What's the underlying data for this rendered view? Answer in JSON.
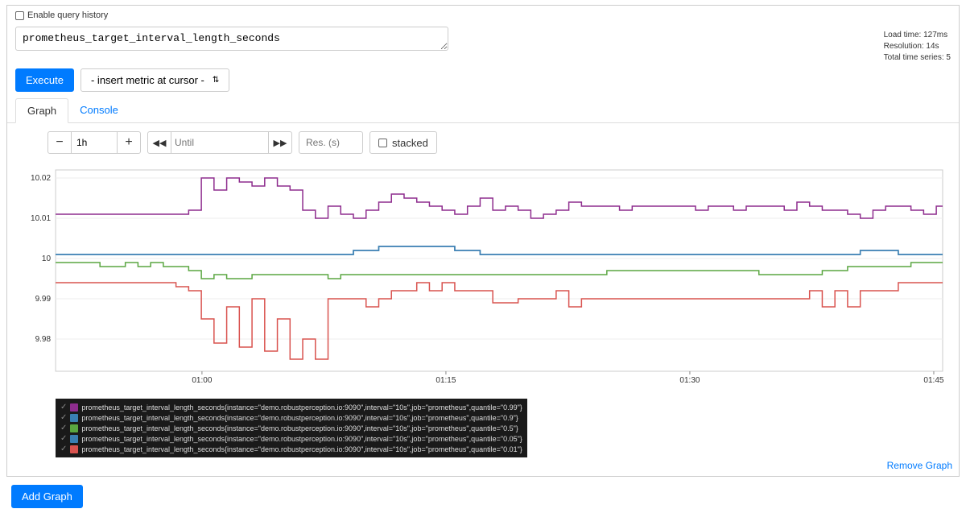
{
  "topbar": {
    "enable_history": "Enable query history"
  },
  "query": {
    "value": "prometheus_target_interval_length_seconds"
  },
  "stats": {
    "load": "Load time: 127ms",
    "res": "Resolution: 14s",
    "series": "Total time series: 5"
  },
  "buttons": {
    "execute": "Execute",
    "insert": "- insert metric at cursor -",
    "add_graph": "Add Graph"
  },
  "tabs": {
    "graph": "Graph",
    "console": "Console"
  },
  "toolbar": {
    "range": "1h",
    "until_ph": "Until",
    "res_ph": "Res. (s)",
    "stacked": "stacked"
  },
  "footer": {
    "remove": "Remove Graph"
  },
  "chart_data": {
    "type": "line",
    "title": "",
    "xlabel": "",
    "ylabel": "",
    "ylim": [
      9.972,
      10.022
    ],
    "yticks": [
      9.98,
      9.99,
      10,
      10.01,
      10.02
    ],
    "x_categories": [
      "01:00",
      "01:15",
      "01:30",
      "01:45"
    ],
    "series": [
      {
        "name": "quantile=\"0.99\"",
        "color": "#8e2d8e",
        "values": [
          10.011,
          10.011,
          10.011,
          10.011,
          10.011,
          10.011,
          10.011,
          10.011,
          10.011,
          10.011,
          10.011,
          10.012,
          10.02,
          10.017,
          10.02,
          10.019,
          10.018,
          10.02,
          10.018,
          10.017,
          10.012,
          10.01,
          10.013,
          10.011,
          10.01,
          10.012,
          10.014,
          10.016,
          10.015,
          10.014,
          10.013,
          10.012,
          10.011,
          10.013,
          10.015,
          10.012,
          10.013,
          10.012,
          10.01,
          10.011,
          10.012,
          10.014,
          10.013,
          10.013,
          10.013,
          10.012,
          10.013,
          10.013,
          10.013,
          10.013,
          10.013,
          10.012,
          10.013,
          10.013,
          10.012,
          10.013,
          10.013,
          10.013,
          10.012,
          10.014,
          10.013,
          10.012,
          10.012,
          10.011,
          10.01,
          10.012,
          10.013,
          10.013,
          10.012,
          10.011,
          10.013
        ]
      },
      {
        "name": "quantile=\"0.9\"",
        "color": "#3a7fb2",
        "values": [
          10.001,
          10.001,
          10.001,
          10.001,
          10.001,
          10.001,
          10.001,
          10.001,
          10.001,
          10.001,
          10.001,
          10.001,
          10.001,
          10.001,
          10.001,
          10.001,
          10.001,
          10.001,
          10.001,
          10.001,
          10.001,
          10.001,
          10.001,
          10.001,
          10.002,
          10.002,
          10.003,
          10.003,
          10.003,
          10.003,
          10.003,
          10.003,
          10.002,
          10.002,
          10.001,
          10.001,
          10.001,
          10.001,
          10.001,
          10.001,
          10.001,
          10.001,
          10.001,
          10.001,
          10.001,
          10.001,
          10.001,
          10.001,
          10.001,
          10.001,
          10.001,
          10.001,
          10.001,
          10.001,
          10.001,
          10.001,
          10.001,
          10.001,
          10.001,
          10.001,
          10.001,
          10.001,
          10.001,
          10.001,
          10.002,
          10.002,
          10.002,
          10.001,
          10.001,
          10.001,
          10.001
        ]
      },
      {
        "name": "quantile=\"0.5\"",
        "color": "#5aa641",
        "values": [
          9.999,
          9.999,
          9.999,
          9.999,
          9.998,
          9.998,
          9.999,
          9.998,
          9.999,
          9.998,
          9.998,
          9.997,
          9.995,
          9.996,
          9.995,
          9.995,
          9.996,
          9.996,
          9.996,
          9.996,
          9.996,
          9.996,
          9.995,
          9.996,
          9.996,
          9.996,
          9.996,
          9.996,
          9.996,
          9.996,
          9.996,
          9.996,
          9.996,
          9.996,
          9.996,
          9.996,
          9.996,
          9.996,
          9.996,
          9.996,
          9.996,
          9.996,
          9.996,
          9.996,
          9.997,
          9.997,
          9.997,
          9.997,
          9.997,
          9.997,
          9.997,
          9.997,
          9.997,
          9.997,
          9.997,
          9.997,
          9.996,
          9.996,
          9.996,
          9.996,
          9.996,
          9.997,
          9.997,
          9.998,
          9.998,
          9.998,
          9.998,
          9.998,
          9.999,
          9.999,
          9.999
        ]
      },
      {
        "name": "quantile=\"0.05\"",
        "color": "#3a7fb2",
        "values": [
          10.001,
          10.001,
          10.001,
          10.001,
          10.001,
          10.001,
          10.001,
          10.001,
          10.001,
          10.001,
          10.001,
          10.001,
          10.001,
          10.001,
          10.001,
          10.001,
          10.001,
          10.001,
          10.001,
          10.001,
          10.001,
          10.001,
          10.001,
          10.001,
          10.002,
          10.002,
          10.003,
          10.003,
          10.003,
          10.003,
          10.003,
          10.003,
          10.002,
          10.002,
          10.001,
          10.001,
          10.001,
          10.001,
          10.001,
          10.001,
          10.001,
          10.001,
          10.001,
          10.001,
          10.001,
          10.001,
          10.001,
          10.001,
          10.001,
          10.001,
          10.001,
          10.001,
          10.001,
          10.001,
          10.001,
          10.001,
          10.001,
          10.001,
          10.001,
          10.001,
          10.001,
          10.001,
          10.001,
          10.001,
          10.002,
          10.002,
          10.002,
          10.001,
          10.001,
          10.001,
          10.001
        ]
      },
      {
        "name": "quantile=\"0.01\"",
        "color": "#d9534f",
        "values": [
          9.994,
          9.994,
          9.994,
          9.994,
          9.994,
          9.994,
          9.994,
          9.994,
          9.994,
          9.994,
          9.993,
          9.992,
          9.985,
          9.979,
          9.988,
          9.978,
          9.99,
          9.977,
          9.985,
          9.975,
          9.98,
          9.975,
          9.99,
          9.99,
          9.99,
          9.988,
          9.99,
          9.992,
          9.992,
          9.994,
          9.992,
          9.994,
          9.992,
          9.992,
          9.992,
          9.989,
          9.989,
          9.99,
          9.99,
          9.99,
          9.992,
          9.988,
          9.99,
          9.99,
          9.99,
          9.99,
          9.99,
          9.99,
          9.99,
          9.99,
          9.99,
          9.99,
          9.99,
          9.99,
          9.99,
          9.99,
          9.99,
          9.99,
          9.99,
          9.99,
          9.992,
          9.988,
          9.992,
          9.988,
          9.992,
          9.992,
          9.992,
          9.994,
          9.994,
          9.994,
          9.994
        ]
      }
    ]
  },
  "legend": {
    "items": [
      {
        "color": "#8e2d8e",
        "label": "prometheus_target_interval_length_seconds{instance=\"demo.robustperception.io:9090\",interval=\"10s\",job=\"prometheus\",quantile=\"0.99\"}"
      },
      {
        "color": "#3a7fb2",
        "label": "prometheus_target_interval_length_seconds{instance=\"demo.robustperception.io:9090\",interval=\"10s\",job=\"prometheus\",quantile=\"0.9\"}"
      },
      {
        "color": "#5aa641",
        "label": "prometheus_target_interval_length_seconds{instance=\"demo.robustperception.io:9090\",interval=\"10s\",job=\"prometheus\",quantile=\"0.5\"}"
      },
      {
        "color": "#3a7fb2",
        "label": "prometheus_target_interval_length_seconds{instance=\"demo.robustperception.io:9090\",interval=\"10s\",job=\"prometheus\",quantile=\"0.05\"}"
      },
      {
        "color": "#d9534f",
        "label": "prometheus_target_interval_length_seconds{instance=\"demo.robustperception.io:9090\",interval=\"10s\",job=\"prometheus\",quantile=\"0.01\"}"
      }
    ]
  }
}
